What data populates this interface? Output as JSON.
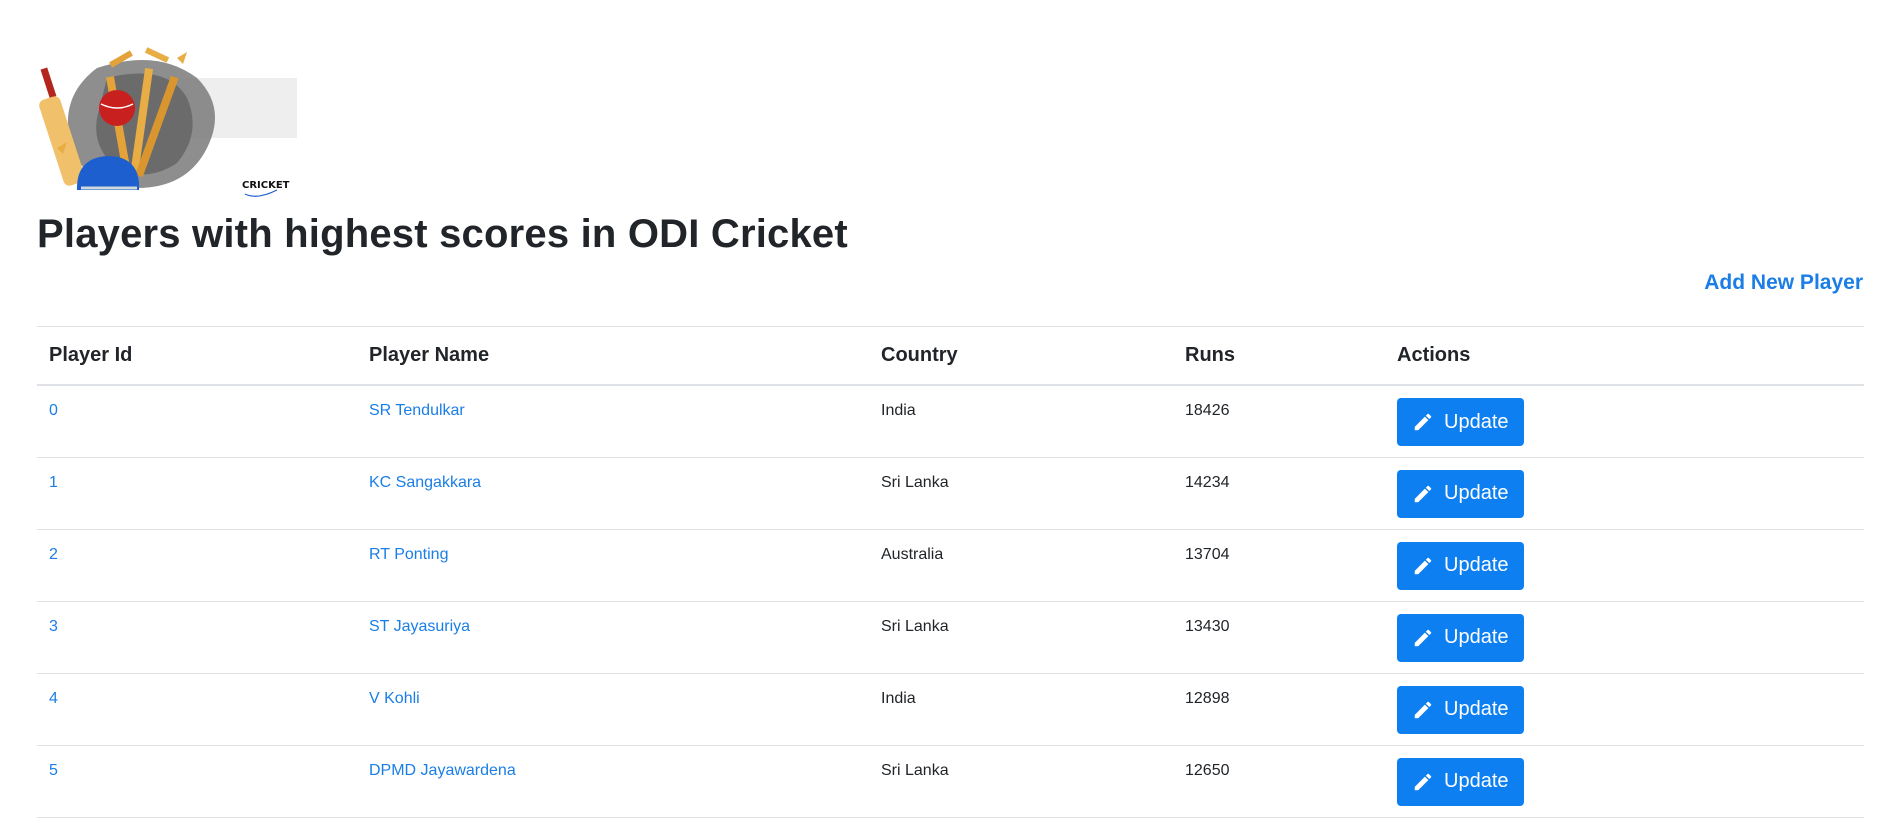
{
  "page": {
    "title": "Players with highest scores in ODI Cricket",
    "add_link": "Add New Player",
    "logo_text": "CRICKET"
  },
  "table": {
    "headers": [
      "Player Id",
      "Player Name",
      "Country",
      "Runs",
      "Actions"
    ],
    "rows": [
      {
        "id": "0",
        "name": "SR Tendulkar",
        "country": "India",
        "runs": "18426",
        "action": "Update"
      },
      {
        "id": "1",
        "name": "KC Sangakkara",
        "country": "Sri Lanka",
        "runs": "14234",
        "action": "Update"
      },
      {
        "id": "2",
        "name": "RT Ponting",
        "country": "Australia",
        "runs": "13704",
        "action": "Update"
      },
      {
        "id": "3",
        "name": "ST Jayasuriya",
        "country": "Sri Lanka",
        "runs": "13430",
        "action": "Update"
      },
      {
        "id": "4",
        "name": "V Kohli",
        "country": "India",
        "runs": "12898",
        "action": "Update"
      },
      {
        "id": "5",
        "name": "DPMD Jayawardena",
        "country": "Sri Lanka",
        "runs": "12650",
        "action": "Update"
      }
    ]
  },
  "colors": {
    "link": "#1a7ee6",
    "button": "#0d7ff0",
    "text": "#212529",
    "border": "#dee2e6"
  },
  "icons": {
    "logo": "cricket-logo-image",
    "update": "pencil-icon"
  }
}
